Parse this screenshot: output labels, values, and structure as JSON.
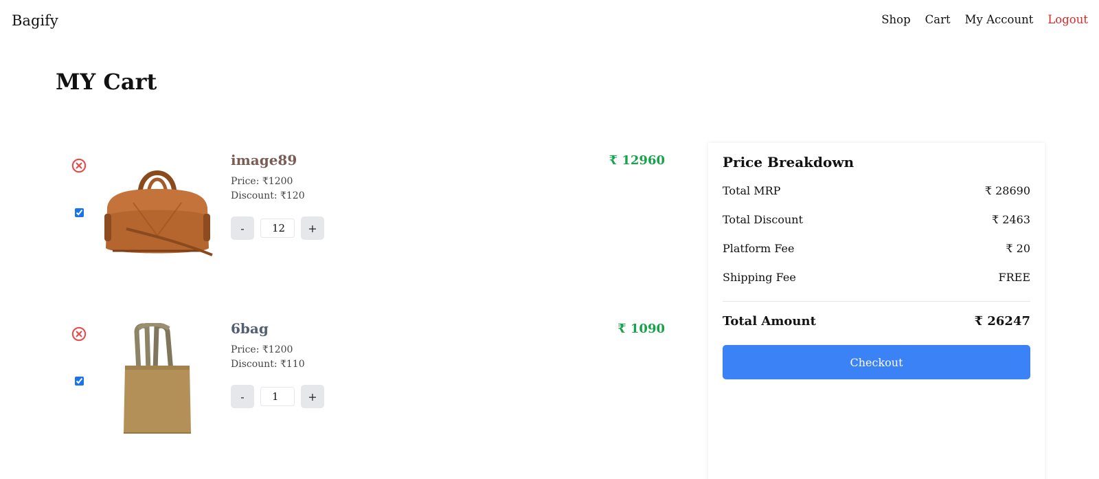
{
  "nav": {
    "brand": "Bagify",
    "links": [
      "Shop",
      "Cart",
      "My Account"
    ],
    "logout": "Logout",
    "logout_color": "#dc2626"
  },
  "page_title": "MY Cart",
  "items": [
    {
      "name": "image89",
      "name_color": "#7a5c56",
      "price": "Price: ₹1200",
      "discount": "Discount: ₹120",
      "quantity": "12",
      "total": "₹ 12960",
      "selected": true,
      "image_icon": "duffel-bag-image"
    },
    {
      "name": "6bag",
      "name_color": "#536073",
      "price": "Price: ₹1200",
      "discount": "Discount: ₹110",
      "quantity": "1",
      "total": "₹ 1090",
      "selected": true,
      "image_icon": "tote-bag-image"
    }
  ],
  "qty_controls": {
    "minus": "-",
    "plus": "+"
  },
  "summary": {
    "title": "Price Breakdown",
    "rows": [
      {
        "label": "Total MRP",
        "value": "₹ 28690"
      },
      {
        "label": "Total Discount",
        "value": "₹ 2463"
      },
      {
        "label": "Platform Fee",
        "value": "₹ 20"
      },
      {
        "label": "Shipping Fee",
        "value": "FREE"
      }
    ],
    "total_label": "Total Amount",
    "total_value": "₹ 26247",
    "checkout_label": "Checkout"
  },
  "colors": {
    "price_green": "#16a34a",
    "checkout_blue": "#3b82f6",
    "remove_red": "#ef4444"
  }
}
